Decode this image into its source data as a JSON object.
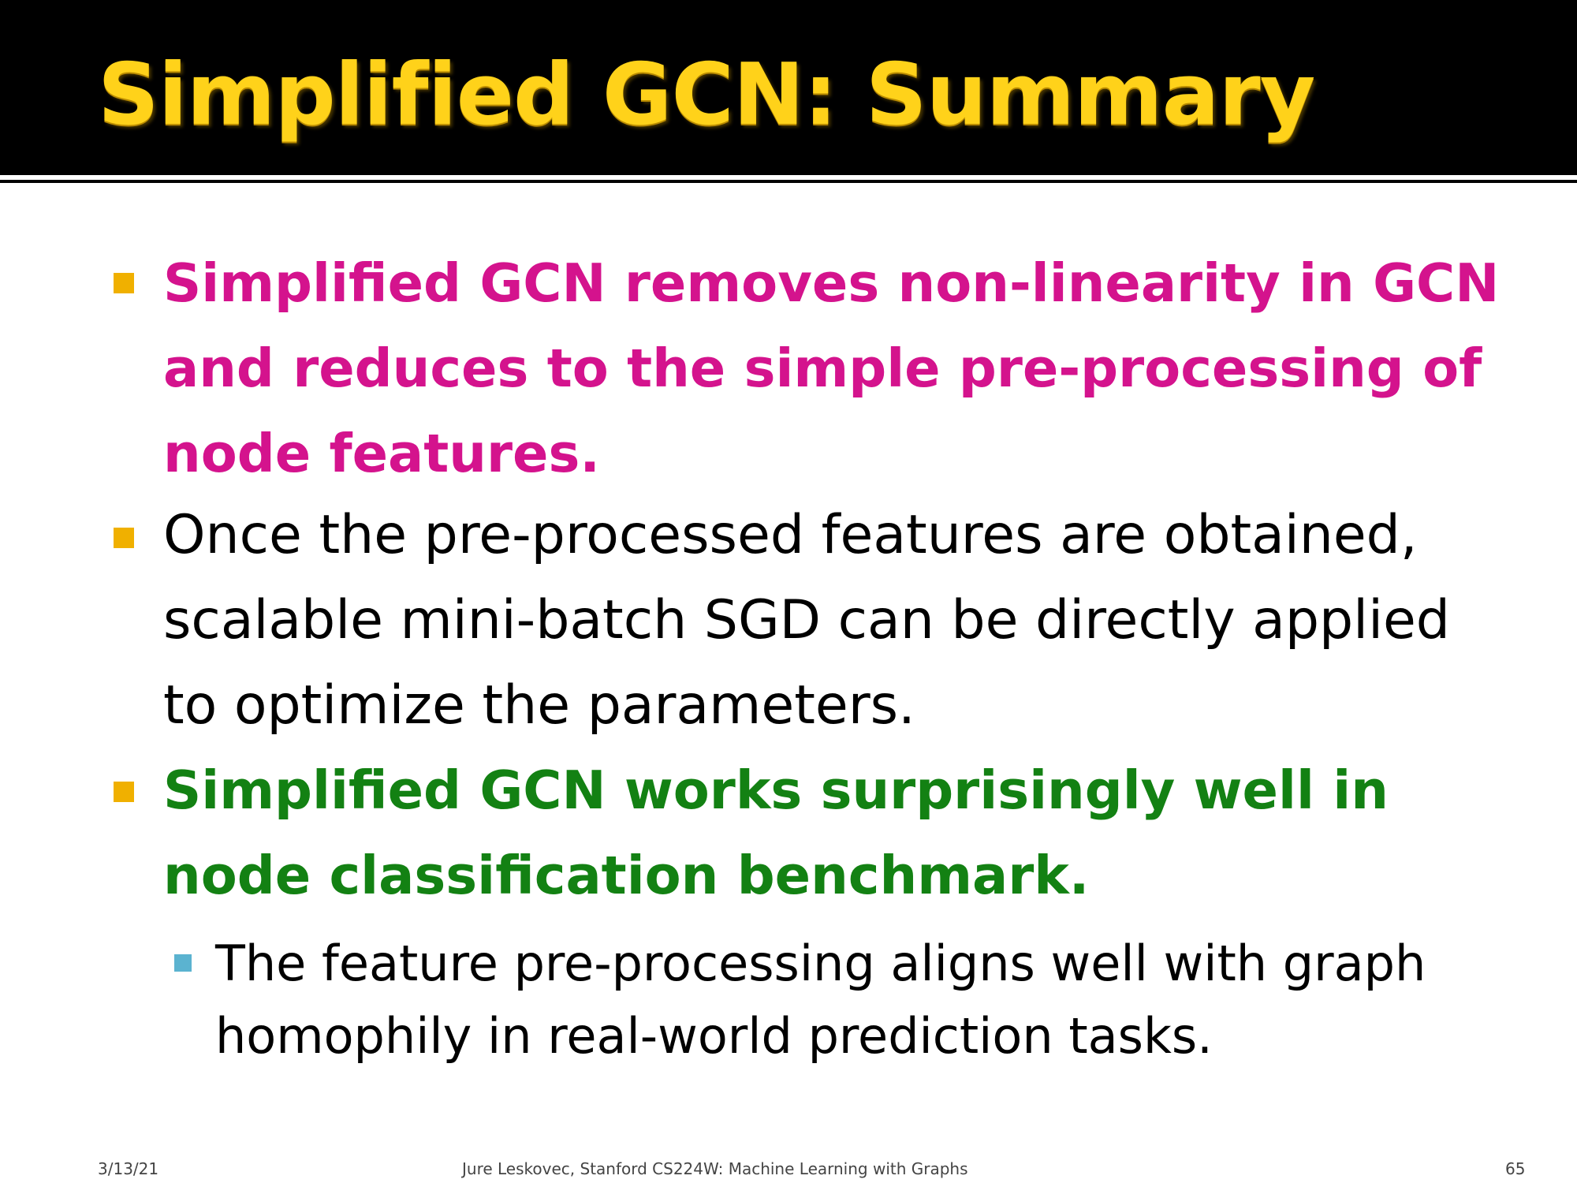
{
  "slide": {
    "title": "Simplified GCN: Summary",
    "bullets": [
      {
        "text": "Simplified GCN removes non-linearity in GCN and reduces to the simple pre-processing of node features.",
        "color": "#d4138d"
      },
      {
        "text": "Once the pre-processed features are obtained, scalable mini-batch SGD can be directly applied to optimize the parameters.",
        "color": "#000000"
      },
      {
        "text": "Simplified GCN works surprisingly well in node classification benchmark.",
        "color": "#138113"
      }
    ],
    "sub_bullets": [
      {
        "text": "The feature pre-processing aligns well with graph homophily in real-world prediction tasks."
      }
    ]
  },
  "footer": {
    "date": "3/13/21",
    "center": "Jure Leskovec, Stanford CS224W: Machine Learning with Graphs",
    "page": "65"
  },
  "colors": {
    "title": "#ffd21a",
    "title_bar": "#000000",
    "bullet_marker": "#f0b000",
    "sub_bullet_marker": "#5bb3d0"
  }
}
